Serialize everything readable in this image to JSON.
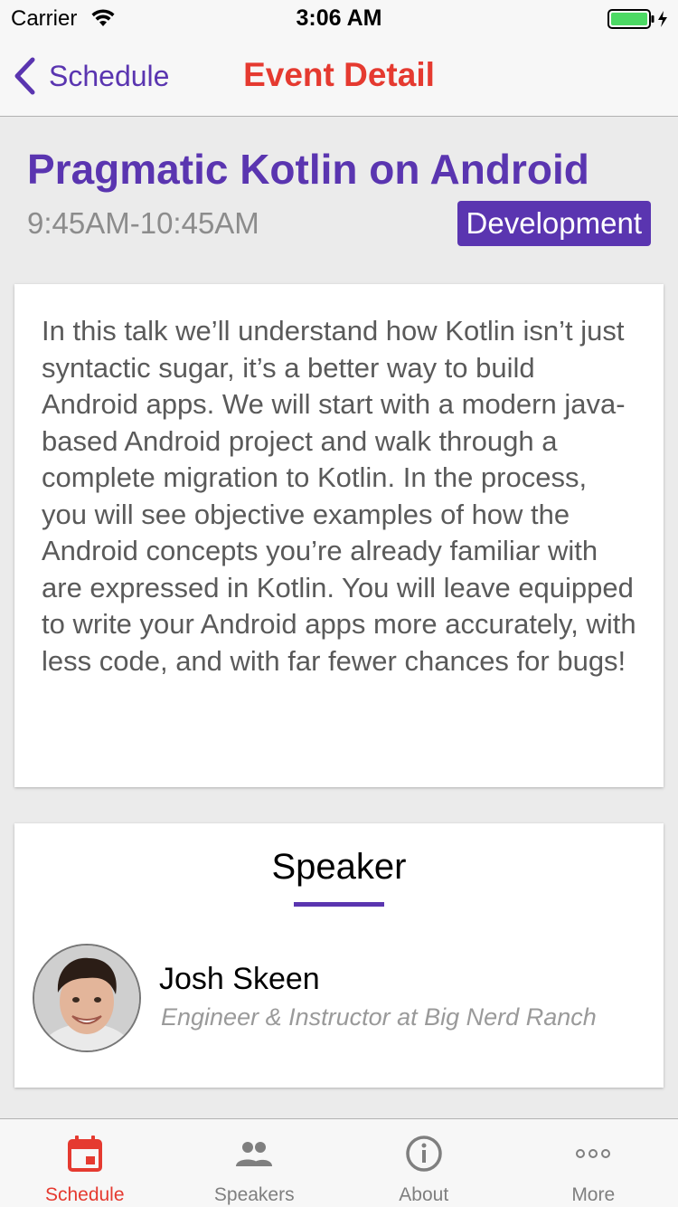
{
  "status_bar": {
    "carrier": "Carrier",
    "time": "3:06 AM",
    "battery_color": "#4cd964"
  },
  "nav": {
    "back_label": "Schedule",
    "title": "Event Detail"
  },
  "event": {
    "title": "Pragmatic Kotlin on Android",
    "time": "9:45AM-10:45AM",
    "category": "Development",
    "description": "In this talk we’ll understand how Kotlin isn’t just syntactic sugar, it’s a better way to build Android apps. We will start with a modern java-based Android project and walk through a complete migration to Kotlin. In the process, you will see objective examples of how the Android concepts you’re already familiar with are expressed in Kotlin. You will leave equipped to write your Android apps more accurately, with less code, and with far fewer chances for bugs!"
  },
  "speaker_section": {
    "heading": "Speaker",
    "speaker": {
      "name": "Josh Skeen",
      "title": "Engineer & Instructor at Big Nerd Ranch",
      "avatar_icon": "avatar-photo"
    }
  },
  "tabs": [
    {
      "label": "Schedule",
      "icon": "calendar-icon",
      "active": true
    },
    {
      "label": "Speakers",
      "icon": "people-icon",
      "active": false
    },
    {
      "label": "About",
      "icon": "info-icon",
      "active": false
    },
    {
      "label": "More",
      "icon": "more-icon",
      "active": false
    }
  ],
  "colors": {
    "accent_purple": "#5a35b0",
    "accent_red": "#e53a30",
    "inactive_gray": "#7f7f7f"
  }
}
